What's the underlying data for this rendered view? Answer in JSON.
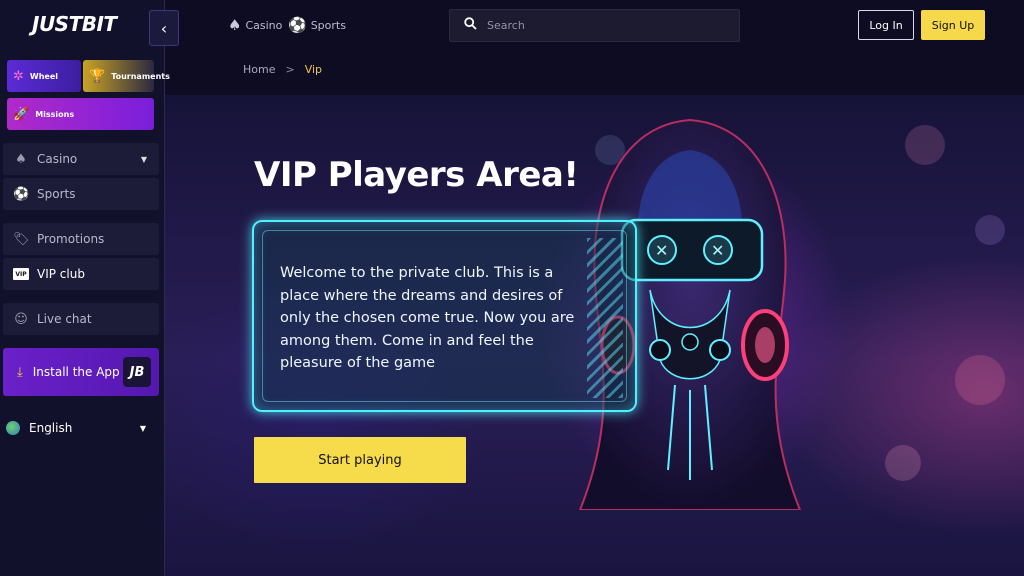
{
  "brand": {
    "logo": "JUSTBIT"
  },
  "sidebar": {
    "promos": [
      {
        "label": "Wheel",
        "icon": "wheel-icon"
      },
      {
        "label": "Tournaments",
        "icon": "trophy-icon"
      },
      {
        "label": "Missions",
        "icon": "rocket-icon"
      }
    ],
    "items": [
      {
        "label": "Casino",
        "icon": "spade-icon"
      },
      {
        "label": "Sports",
        "icon": "soccer-ball-icon"
      },
      {
        "label": "Promotions",
        "icon": "tag-icon"
      },
      {
        "label": "VIP club",
        "icon": "vip-icon",
        "icon_text": "VIP"
      },
      {
        "label": "Live chat",
        "icon": "support-agent-icon"
      }
    ],
    "install": {
      "label": "Install the App",
      "badge": "JB"
    },
    "language": "English"
  },
  "topbar": {
    "casino": "Casino",
    "sports": "Sports",
    "search_placeholder": "Search",
    "login": "Log In",
    "signup": "Sign Up"
  },
  "breadcrumb": {
    "home": "Home",
    "separator": ">",
    "current": "Vip"
  },
  "hero": {
    "title": "VIP Players Area!",
    "welcome": "Welcome to the private club. This is a place where the dreams and desires of only the chosen come true. Now you are among them. Come in and feel the pleasure of the game",
    "cta": "Start playing"
  },
  "colors": {
    "accent_yellow": "#f6dc4b",
    "background": "#0d0c22",
    "neon_cyan": "#4ff0ff",
    "purple": "#6b20c9"
  }
}
